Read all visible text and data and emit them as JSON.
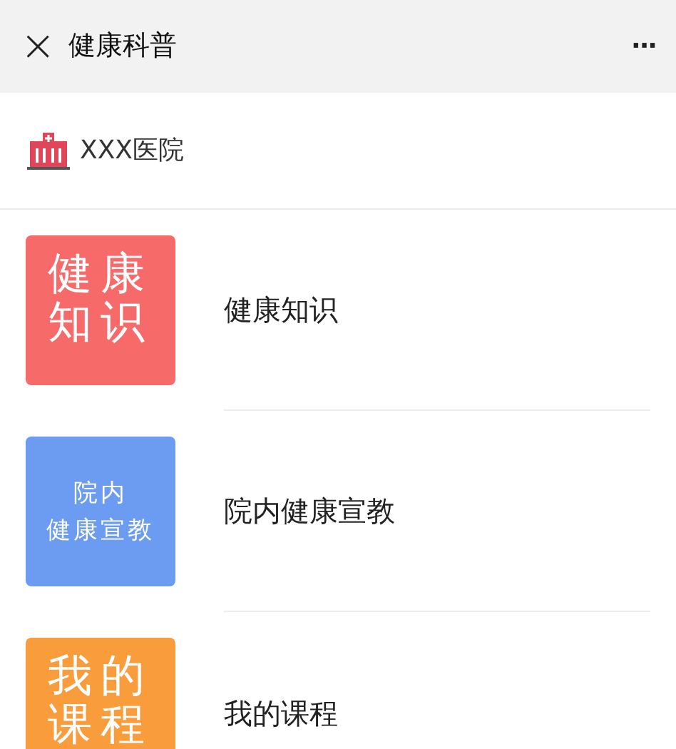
{
  "header": {
    "close": "×",
    "title": "健康科普",
    "more": "···"
  },
  "hospital": {
    "name": "XXX医院"
  },
  "items": [
    {
      "tile_lines": [
        "健康",
        "知识"
      ],
      "kind": "large",
      "color": "#f76a6a",
      "label": "健康知识"
    },
    {
      "tile_lines": [
        "院内",
        "健康宣教"
      ],
      "kind": "small",
      "color": "#6b9cf2",
      "label": "院内健康宣教"
    },
    {
      "tile_lines": [
        "我的",
        "课程"
      ],
      "kind": "large",
      "color": "#f89c3c",
      "label": "我的课程"
    }
  ]
}
